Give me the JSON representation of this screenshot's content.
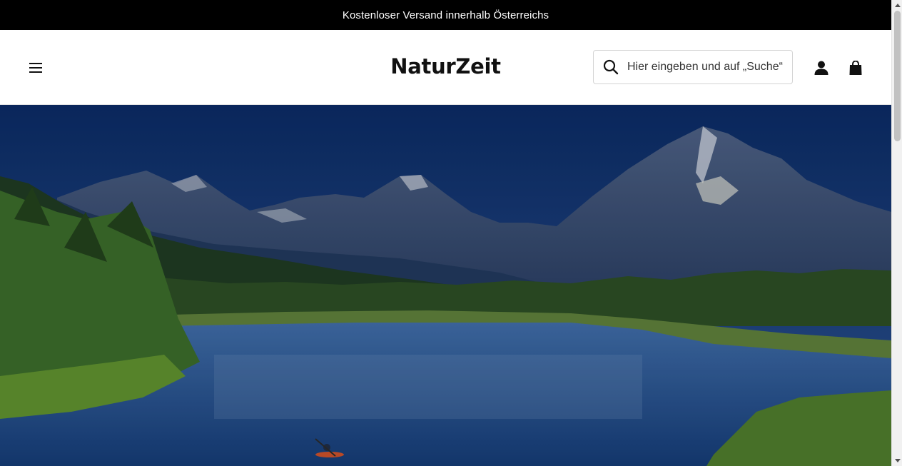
{
  "announcement": {
    "text": "Kostenloser Versand innerhalb Österreichs"
  },
  "header": {
    "logo": "NaturZeit",
    "menu_icon": "hamburger-menu-icon",
    "search": {
      "icon": "search-icon",
      "placeholder": "Hier eingeben und auf „Suche“ drücken",
      "value": ""
    },
    "account_icon": "user-icon",
    "cart_icon": "shopping-bag-icon"
  },
  "hero": {
    "image": "mountain-lake-landscape-with-kayaker",
    "colors": {
      "sky": "#1f4a86",
      "water": "#2d5a97",
      "forest": "#2f5a22"
    }
  },
  "colors": {
    "announcement_bg": "#000000",
    "announcement_text": "#ffffff",
    "header_bg": "#ffffff"
  }
}
